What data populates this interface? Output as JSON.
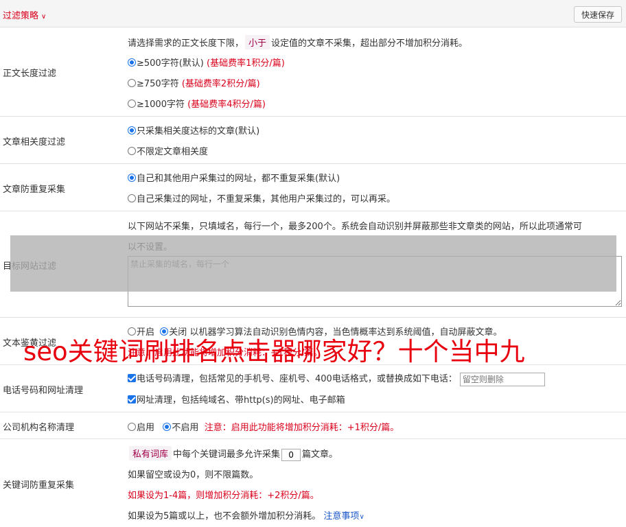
{
  "header": {
    "title": "过滤策略",
    "title_icon": "double-chevron-down-icon",
    "save_button": "快速保存"
  },
  "length_filter": {
    "label": "正文长度过滤",
    "desc_before": "请选择需求的正文长度下限，",
    "desc_tag": "小于",
    "desc_after": "设定值的文章不采集，超出部分不增加积分消耗。",
    "options": [
      {
        "text": "≥500字符(默认)",
        "note": "(基础费率1积分/篇)",
        "checked": true
      },
      {
        "text": "≥750字符",
        "note": "(基础费率2积分/篇)",
        "checked": false
      },
      {
        "text": "≥1000字符",
        "note": "(基础费率4积分/篇)",
        "checked": false
      }
    ]
  },
  "relevance_filter": {
    "label": "文章相关度过滤",
    "options": [
      {
        "text": "只采集相关度达标的文章(默认)",
        "checked": true
      },
      {
        "text": "不限定文章相关度",
        "checked": false
      }
    ]
  },
  "dedup": {
    "label": "文章防重复采集",
    "options": [
      {
        "text": "自己和其他用户采集过的网址，都不重复采集(默认)",
        "checked": true
      },
      {
        "text": "自己采集过的网址，不重复采集，其他用户采集过的，可以再采。",
        "checked": false
      }
    ]
  },
  "site_filter": {
    "label": "目标网站过滤",
    "desc_line1": "以下网站不采集，只填域名，每行一个，最多200个。系统会自动识别并屏蔽那些非文章类的网站，所以此项通常可",
    "desc_line2": "以不设置。",
    "placeholder": "禁止采集的域名，每行一个"
  },
  "porn_filter": {
    "label": "文本鉴黄过滤",
    "opt_on": "开启",
    "opt_off": "关闭",
    "desc": "以机器学习算法自动识别色情内容，当色情概率达到系统阈值，自动屏蔽文章。",
    "note": "注意：启用此功能将增加积分消耗：+1积分/篇。"
  },
  "phone_url": {
    "label": "电话号码和网址清理",
    "phone_text": "电话号码清理，包括常见的手机号、座机号、400电话格式，或替换成如下电话：",
    "phone_placeholder": "留空则删除",
    "url_text": "网址清理，包括纯域名、带http(s)的网址、电子邮箱"
  },
  "company": {
    "label": "公司机构名称清理",
    "opt_on": "启用",
    "opt_off": "不启用",
    "note": "注意：启用此功能将增加积分消耗：+1积分/篇。"
  },
  "keyword_dedup": {
    "label": "关键词防重复采集",
    "tag": "私有词库",
    "text_before": "中每个关键词最多允许采集",
    "value": "0",
    "text_after": "篇文章。",
    "line2": "如果留空或设为0，则不限篇数。",
    "line3": "如果设为1-4篇，则增加积分消耗：+2积分/篇。",
    "line4": "如果设为5篇或以上，也不会额外增加积分消耗。",
    "link": "注意事项",
    "link_icon": "double-chevron-down-icon"
  },
  "watermark": "seo关键词刷排名点击器哪家好？十个当中九"
}
